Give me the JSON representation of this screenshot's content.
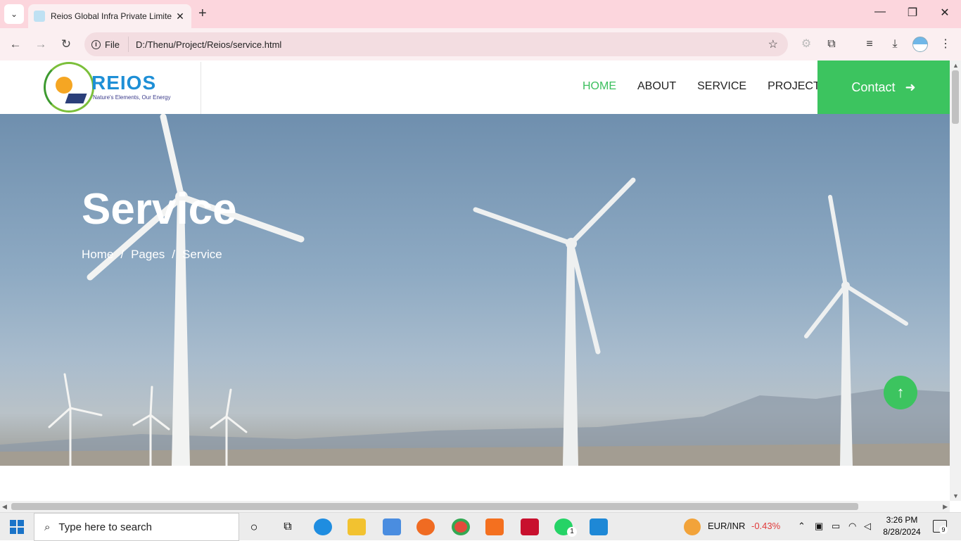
{
  "browser": {
    "tab_title": "Reios Global Infra Private Limite",
    "address_scheme": "File",
    "address_url": "D:/Thenu/Project/Reios/service.html"
  },
  "site": {
    "logo_name": "REIOS",
    "logo_tagline": "Nature's Elements, Our Energy",
    "nav": [
      {
        "label": "HOME",
        "active": true
      },
      {
        "label": "ABOUT",
        "active": false
      },
      {
        "label": "SERVICE",
        "active": false
      },
      {
        "label": "PROJECT",
        "active": false
      }
    ],
    "contact_label": "Contact",
    "accent_color": "#3cc45f"
  },
  "hero": {
    "title": "Service",
    "breadcrumb": [
      "Home",
      "/",
      "Pages",
      "/",
      "Service"
    ]
  },
  "taskbar": {
    "search_placeholder": "Type here to search",
    "ticker_label": "EUR/INR",
    "ticker_change": "-0.43%",
    "time": "3:26 PM",
    "date": "8/28/2024",
    "whatsapp_badge": "1",
    "notification_count": "9"
  }
}
